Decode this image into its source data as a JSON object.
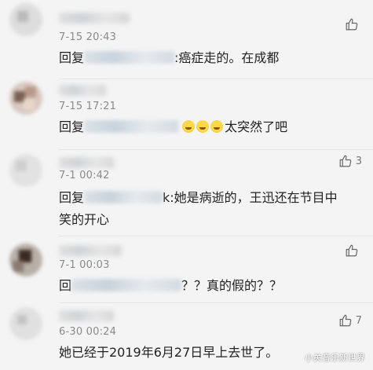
{
  "comments": [
    {
      "time": "7-15 20:43",
      "reply_prefix": "回复",
      "reply_text": ":癌症走的。在成都",
      "likes": "",
      "has_emoji": false
    },
    {
      "time": "7-15 17:21",
      "reply_prefix": "回复",
      "reply_text": "太突然了吧",
      "likes": "",
      "has_emoji": true
    },
    {
      "time": "7-1 00:42",
      "reply_prefix": "回复",
      "reply_text": "k:她是病逝的，王迅还在节目中笑的开心",
      "likes": "3",
      "has_emoji": false
    },
    {
      "time": "7-1 00:03",
      "reply_prefix": "回",
      "reply_text": "？？真的假的？？",
      "likes": "",
      "has_emoji": false
    },
    {
      "time": "6-30 00:24",
      "reply_prefix": "",
      "reply_text": "她已经于2019年6月27日早上去世了。",
      "likes": "7",
      "has_emoji": false
    }
  ],
  "icons": {
    "like": "thumbs-up-icon"
  },
  "watermark": "小关音乐新世界"
}
